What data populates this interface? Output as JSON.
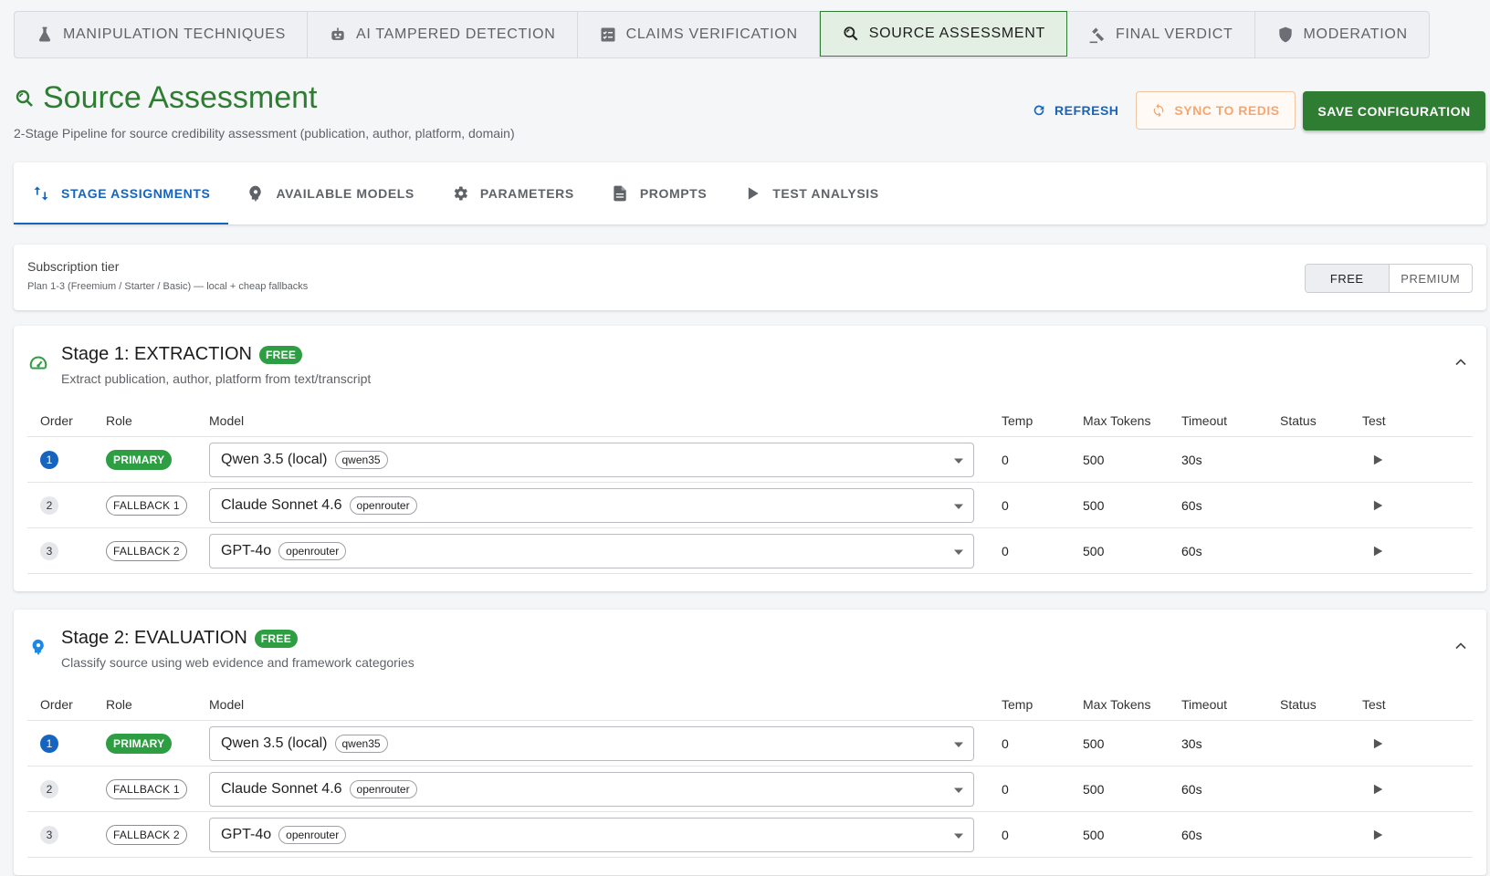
{
  "top_tabs": [
    {
      "label": "MANIPULATION TECHNIQUES",
      "icon": "flask-icon"
    },
    {
      "label": "AI TAMPERED DETECTION",
      "icon": "robot-icon"
    },
    {
      "label": "CLAIMS VERIFICATION",
      "icon": "checklist-icon"
    },
    {
      "label": "SOURCE ASSESSMENT",
      "icon": "source-search-icon",
      "active": true
    },
    {
      "label": "FINAL VERDICT",
      "icon": "gavel-icon"
    },
    {
      "label": "MODERATION",
      "icon": "shield-icon"
    }
  ],
  "header": {
    "title": "Source Assessment",
    "subtitle": "2-Stage Pipeline for source credibility assessment (publication, author, platform, domain)",
    "refresh_label": "REFRESH",
    "sync_label": "SYNC TO REDIS",
    "save_label": "SAVE CONFIGURATION"
  },
  "sub_tabs": [
    {
      "label": "STAGE ASSIGNMENTS",
      "icon": "swap-vertical-icon",
      "active": true
    },
    {
      "label": "AVAILABLE MODELS",
      "icon": "brain-icon"
    },
    {
      "label": "PARAMETERS",
      "icon": "gear-icon"
    },
    {
      "label": "PROMPTS",
      "icon": "document-icon"
    },
    {
      "label": "TEST ANALYSIS",
      "icon": "play-icon"
    }
  ],
  "tier": {
    "title": "Subscription tier",
    "description": "Plan 1-3 (Freemium / Starter / Basic) — local + cheap fallbacks",
    "options": [
      "FREE",
      "PREMIUM"
    ],
    "selected": "FREE"
  },
  "columns": [
    "Order",
    "Role",
    "Model",
    "Temp",
    "Max Tokens",
    "Timeout",
    "Status",
    "Test"
  ],
  "stages": [
    {
      "title": "Stage 1: EXTRACTION",
      "badge": "FREE",
      "description": "Extract publication, author, platform from text/transcript",
      "icon": "speedometer-icon",
      "rows": [
        {
          "order": "1",
          "role": "PRIMARY",
          "model": "Qwen 3.5 (local)",
          "provider": "qwen35",
          "temp": "0",
          "max_tokens": "500",
          "timeout": "30s",
          "status": ""
        },
        {
          "order": "2",
          "role": "FALLBACK 1",
          "model": "Claude Sonnet 4.6",
          "provider": "openrouter",
          "temp": "0",
          "max_tokens": "500",
          "timeout": "60s",
          "status": ""
        },
        {
          "order": "3",
          "role": "FALLBACK 2",
          "model": "GPT-4o",
          "provider": "openrouter",
          "temp": "0",
          "max_tokens": "500",
          "timeout": "60s",
          "status": ""
        }
      ]
    },
    {
      "title": "Stage 2: EVALUATION",
      "badge": "FREE",
      "description": "Classify source using web evidence and framework categories",
      "icon": "brain-icon",
      "rows": [
        {
          "order": "1",
          "role": "PRIMARY",
          "model": "Qwen 3.5 (local)",
          "provider": "qwen35",
          "temp": "0",
          "max_tokens": "500",
          "timeout": "30s",
          "status": ""
        },
        {
          "order": "2",
          "role": "FALLBACK 1",
          "model": "Claude Sonnet 4.6",
          "provider": "openrouter",
          "temp": "0",
          "max_tokens": "500",
          "timeout": "60s",
          "status": ""
        },
        {
          "order": "3",
          "role": "FALLBACK 2",
          "model": "GPT-4o",
          "provider": "openrouter",
          "temp": "0",
          "max_tokens": "500",
          "timeout": "60s",
          "status": ""
        }
      ]
    }
  ],
  "colors": {
    "brand_green": "#2e7d32",
    "accent_blue": "#1565c0",
    "sync_orange": "#f5a770",
    "badge_green": "#2e9e43"
  }
}
